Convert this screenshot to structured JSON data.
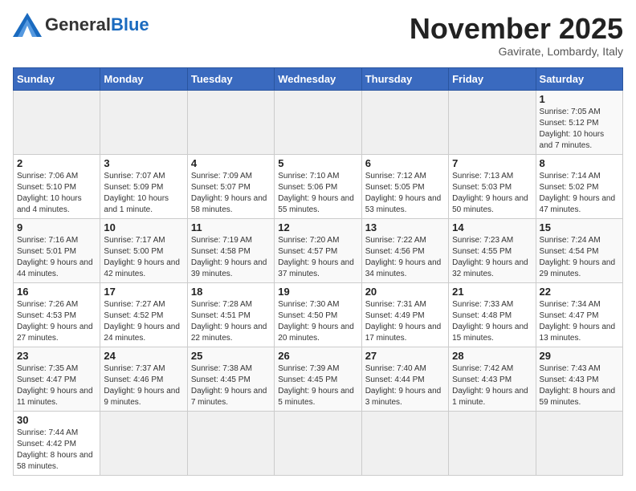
{
  "header": {
    "logo_general": "General",
    "logo_blue": "Blue",
    "month_title": "November 2025",
    "location": "Gavirate, Lombardy, Italy"
  },
  "weekdays": [
    "Sunday",
    "Monday",
    "Tuesday",
    "Wednesday",
    "Thursday",
    "Friday",
    "Saturday"
  ],
  "weeks": [
    [
      {
        "day": "",
        "info": ""
      },
      {
        "day": "",
        "info": ""
      },
      {
        "day": "",
        "info": ""
      },
      {
        "day": "",
        "info": ""
      },
      {
        "day": "",
        "info": ""
      },
      {
        "day": "",
        "info": ""
      },
      {
        "day": "1",
        "info": "Sunrise: 7:05 AM\nSunset: 5:12 PM\nDaylight: 10 hours and 7 minutes."
      }
    ],
    [
      {
        "day": "2",
        "info": "Sunrise: 7:06 AM\nSunset: 5:10 PM\nDaylight: 10 hours and 4 minutes."
      },
      {
        "day": "3",
        "info": "Sunrise: 7:07 AM\nSunset: 5:09 PM\nDaylight: 10 hours and 1 minute."
      },
      {
        "day": "4",
        "info": "Sunrise: 7:09 AM\nSunset: 5:07 PM\nDaylight: 9 hours and 58 minutes."
      },
      {
        "day": "5",
        "info": "Sunrise: 7:10 AM\nSunset: 5:06 PM\nDaylight: 9 hours and 55 minutes."
      },
      {
        "day": "6",
        "info": "Sunrise: 7:12 AM\nSunset: 5:05 PM\nDaylight: 9 hours and 53 minutes."
      },
      {
        "day": "7",
        "info": "Sunrise: 7:13 AM\nSunset: 5:03 PM\nDaylight: 9 hours and 50 minutes."
      },
      {
        "day": "8",
        "info": "Sunrise: 7:14 AM\nSunset: 5:02 PM\nDaylight: 9 hours and 47 minutes."
      }
    ],
    [
      {
        "day": "9",
        "info": "Sunrise: 7:16 AM\nSunset: 5:01 PM\nDaylight: 9 hours and 44 minutes."
      },
      {
        "day": "10",
        "info": "Sunrise: 7:17 AM\nSunset: 5:00 PM\nDaylight: 9 hours and 42 minutes."
      },
      {
        "day": "11",
        "info": "Sunrise: 7:19 AM\nSunset: 4:58 PM\nDaylight: 9 hours and 39 minutes."
      },
      {
        "day": "12",
        "info": "Sunrise: 7:20 AM\nSunset: 4:57 PM\nDaylight: 9 hours and 37 minutes."
      },
      {
        "day": "13",
        "info": "Sunrise: 7:22 AM\nSunset: 4:56 PM\nDaylight: 9 hours and 34 minutes."
      },
      {
        "day": "14",
        "info": "Sunrise: 7:23 AM\nSunset: 4:55 PM\nDaylight: 9 hours and 32 minutes."
      },
      {
        "day": "15",
        "info": "Sunrise: 7:24 AM\nSunset: 4:54 PM\nDaylight: 9 hours and 29 minutes."
      }
    ],
    [
      {
        "day": "16",
        "info": "Sunrise: 7:26 AM\nSunset: 4:53 PM\nDaylight: 9 hours and 27 minutes."
      },
      {
        "day": "17",
        "info": "Sunrise: 7:27 AM\nSunset: 4:52 PM\nDaylight: 9 hours and 24 minutes."
      },
      {
        "day": "18",
        "info": "Sunrise: 7:28 AM\nSunset: 4:51 PM\nDaylight: 9 hours and 22 minutes."
      },
      {
        "day": "19",
        "info": "Sunrise: 7:30 AM\nSunset: 4:50 PM\nDaylight: 9 hours and 20 minutes."
      },
      {
        "day": "20",
        "info": "Sunrise: 7:31 AM\nSunset: 4:49 PM\nDaylight: 9 hours and 17 minutes."
      },
      {
        "day": "21",
        "info": "Sunrise: 7:33 AM\nSunset: 4:48 PM\nDaylight: 9 hours and 15 minutes."
      },
      {
        "day": "22",
        "info": "Sunrise: 7:34 AM\nSunset: 4:47 PM\nDaylight: 9 hours and 13 minutes."
      }
    ],
    [
      {
        "day": "23",
        "info": "Sunrise: 7:35 AM\nSunset: 4:47 PM\nDaylight: 9 hours and 11 minutes."
      },
      {
        "day": "24",
        "info": "Sunrise: 7:37 AM\nSunset: 4:46 PM\nDaylight: 9 hours and 9 minutes."
      },
      {
        "day": "25",
        "info": "Sunrise: 7:38 AM\nSunset: 4:45 PM\nDaylight: 9 hours and 7 minutes."
      },
      {
        "day": "26",
        "info": "Sunrise: 7:39 AM\nSunset: 4:45 PM\nDaylight: 9 hours and 5 minutes."
      },
      {
        "day": "27",
        "info": "Sunrise: 7:40 AM\nSunset: 4:44 PM\nDaylight: 9 hours and 3 minutes."
      },
      {
        "day": "28",
        "info": "Sunrise: 7:42 AM\nSunset: 4:43 PM\nDaylight: 9 hours and 1 minute."
      },
      {
        "day": "29",
        "info": "Sunrise: 7:43 AM\nSunset: 4:43 PM\nDaylight: 8 hours and 59 minutes."
      }
    ],
    [
      {
        "day": "30",
        "info": "Sunrise: 7:44 AM\nSunset: 4:42 PM\nDaylight: 8 hours and 58 minutes."
      },
      {
        "day": "",
        "info": ""
      },
      {
        "day": "",
        "info": ""
      },
      {
        "day": "",
        "info": ""
      },
      {
        "day": "",
        "info": ""
      },
      {
        "day": "",
        "info": ""
      },
      {
        "day": "",
        "info": ""
      }
    ]
  ]
}
